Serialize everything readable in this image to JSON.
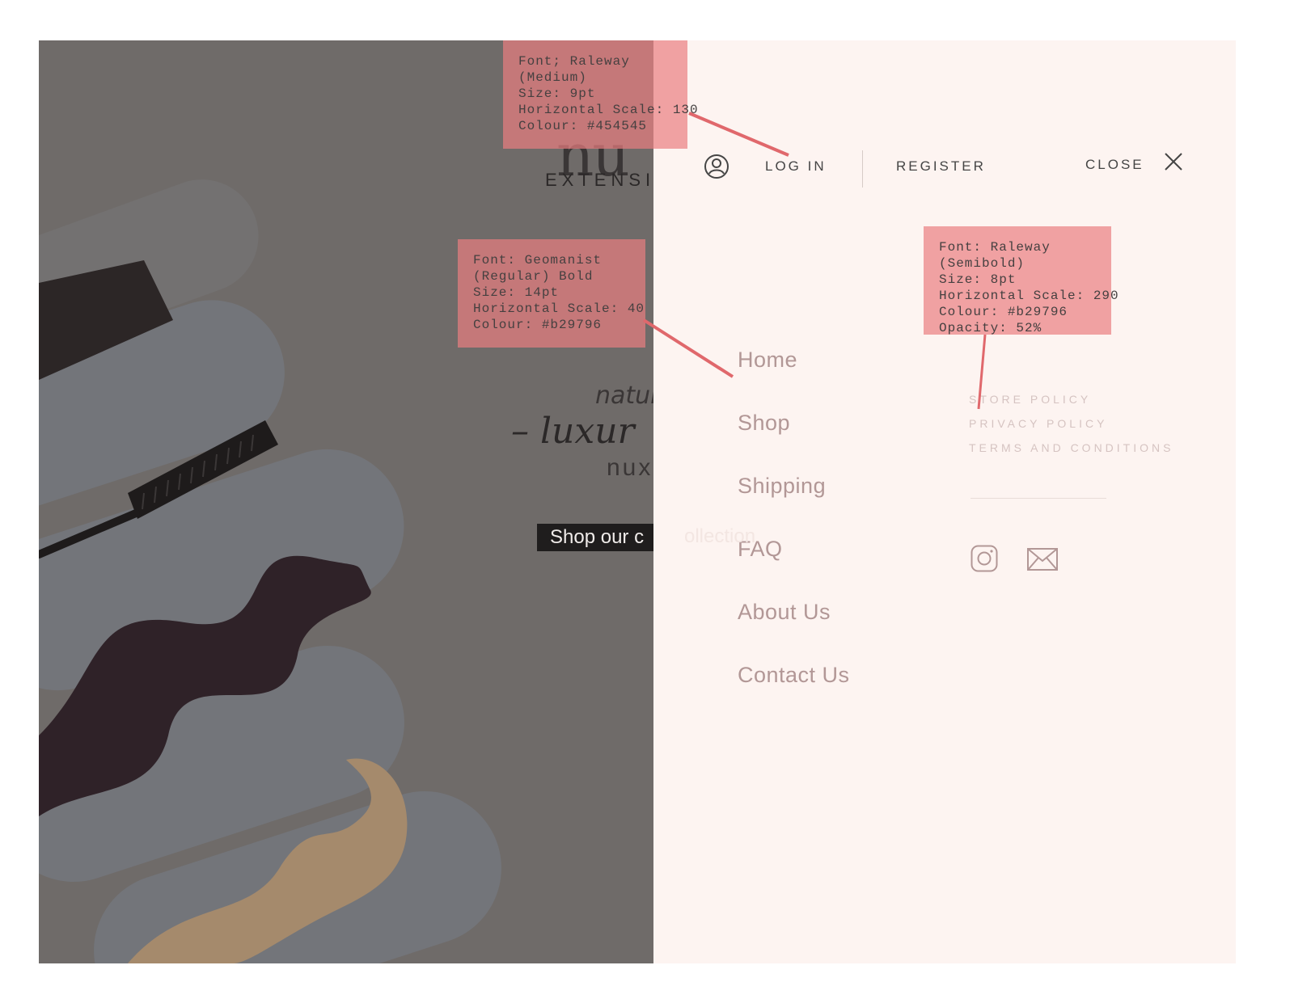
{
  "hero": {
    "logo_sub": "EXTENSIC",
    "tagline_line1": "natur",
    "tagline_line2": "– luxur",
    "tagline_line3": "nuxe",
    "cta_label": "Shop our c",
    "cta_faded": "ollection"
  },
  "menu": {
    "login_label": "LOG IN",
    "register_label": "REGISTER",
    "close_label": "CLOSE",
    "nav_items": [
      {
        "label": "Home"
      },
      {
        "label": "Shop"
      },
      {
        "label": "Shipping"
      },
      {
        "label": "FAQ"
      },
      {
        "label": "About Us"
      },
      {
        "label": "Contact Us"
      }
    ],
    "secondary_links": [
      {
        "label": "STORE POLICY"
      },
      {
        "label": "PRIVACY POLICY"
      },
      {
        "label": "TERMS AND CONDITIONS"
      }
    ],
    "social_icons": [
      "instagram-icon",
      "mail-icon"
    ]
  },
  "annotations": [
    {
      "text": "Font; Raleway\n(Medium)\nSize: 9pt\nHorizontal Scale: 130\nColour: #454545"
    },
    {
      "text": "Font: Geomanist\n(Regular) Bold\nSize: 14pt\nHorizontal Scale: 40\nColour: #b29796"
    },
    {
      "text": "Font: Raleway\n(Semibold)\nSize: 8pt\nHorizontal Scale: 290\nColour: #b29796\nOpacity: 52%"
    }
  ],
  "colors": {
    "menu_bg": "#fdf4f1",
    "nav_text": "#b29796",
    "topbar_text": "#454545",
    "hero_overlay": "#6f6b69",
    "annotation_bg": "#e97e80"
  }
}
